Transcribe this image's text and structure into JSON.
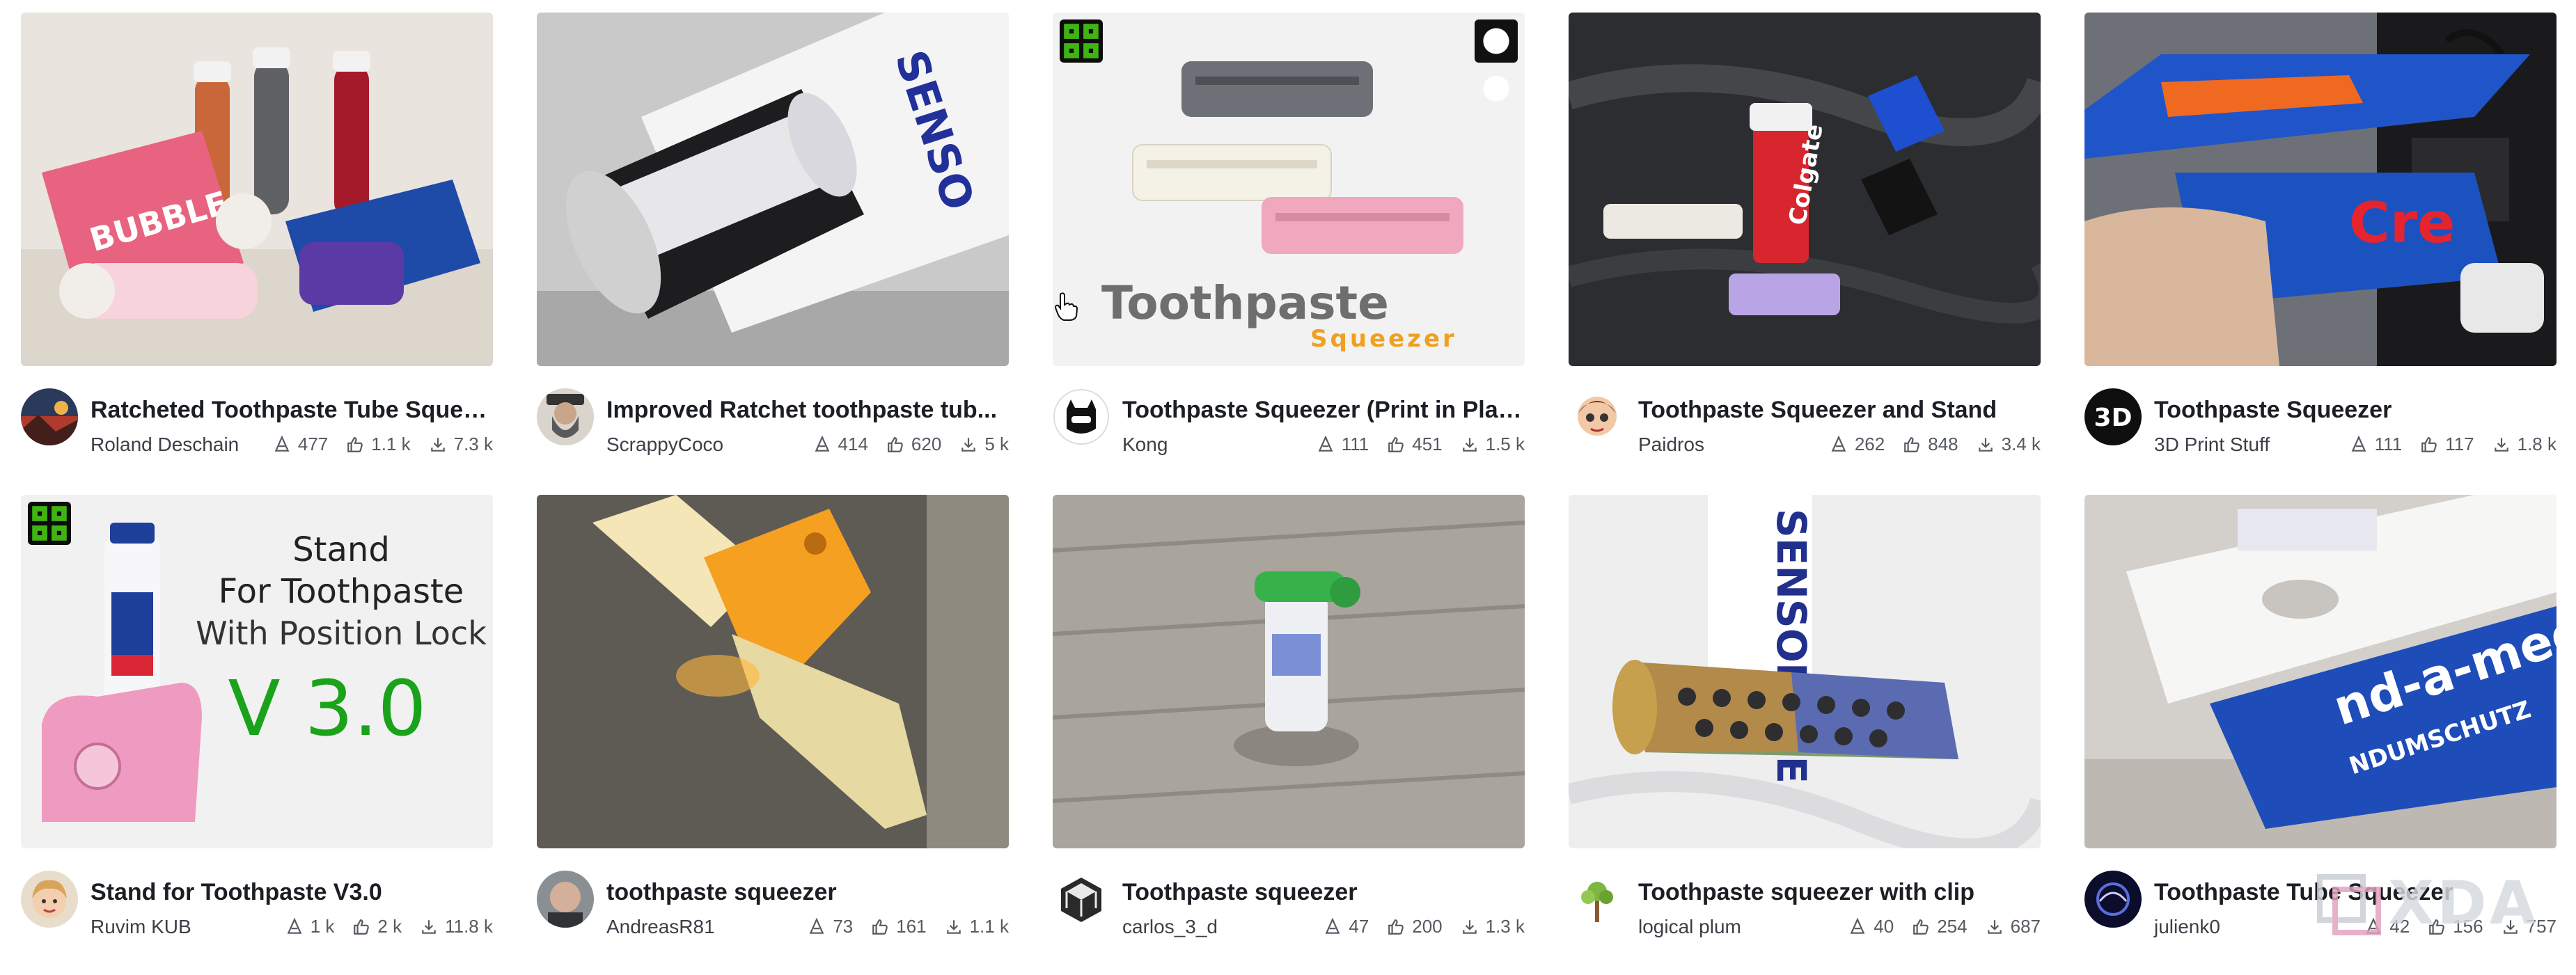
{
  "cards": [
    {
      "title": "Ratcheted Toothpaste Tube Squee...",
      "author": "Roland Deschain",
      "makes": "477",
      "likes": "1.1 k",
      "downloads": "7.3 k",
      "thumb_icon": "toothpaste-tubes-photo",
      "avatar_icon": "landscape-avatar-icon"
    },
    {
      "title": "Improved Ratchet toothpaste tub...",
      "author": "ScrappyCoco",
      "makes": "414",
      "likes": "620",
      "downloads": "5 k",
      "thumb_icon": "sensodyne-tube-photo",
      "avatar_icon": "bearded-man-avatar-icon"
    },
    {
      "title": "Toothpaste Squeezer (Print in Place)",
      "author": "Kong",
      "makes": "111",
      "likes": "451",
      "downloads": "1.5 k",
      "thumb_icon": "squeezer-keys-photo",
      "avatar_icon": "robot-head-avatar-icon",
      "thumb_text": "Toothpaste",
      "thumb_subtext": "Squeezer"
    },
    {
      "title": "Toothpaste Squeezer and Stand",
      "author": "Paidros",
      "makes": "262",
      "likes": "848",
      "downloads": "3.4 k",
      "thumb_icon": "colgate-tube-photo",
      "avatar_icon": "cartoon-avatar-icon"
    },
    {
      "title": "Toothpaste Squeezer",
      "author": "3D Print Stuff",
      "makes": "111",
      "likes": "117",
      "downloads": "1.8 k",
      "thumb_icon": "hand-printer-photo",
      "avatar_icon": "3d-logo-avatar-icon",
      "avatar_text": "3D"
    },
    {
      "title": "Stand for Toothpaste V3.0",
      "author": "Ruvim KUB",
      "makes": "1 k",
      "likes": "2 k",
      "downloads": "11.8 k",
      "thumb_icon": "pink-stand-photo",
      "avatar_icon": "child-avatar-icon",
      "thumb_lines": [
        "Stand",
        "For Toothpaste",
        "With Position Lock"
      ],
      "thumb_version": "V 3.0"
    },
    {
      "title": "toothpaste squeezer",
      "author": "AndreasR81",
      "makes": "73",
      "likes": "161",
      "downloads": "1.1 k",
      "thumb_icon": "orange-clip-photo",
      "avatar_icon": "bald-man-avatar-icon"
    },
    {
      "title": "Toothpaste squeezer",
      "author": "carlos_3_d",
      "makes": "47",
      "likes": "200",
      "downloads": "1.3 k",
      "thumb_icon": "small-tube-floor-photo",
      "avatar_icon": "cube-avatar-icon"
    },
    {
      "title": "Toothpaste squeezer with clip",
      "author": "logical plum",
      "makes": "40",
      "likes": "254",
      "downloads": "687",
      "thumb_icon": "metal-roller-photo",
      "avatar_icon": "tree-avatar-icon"
    },
    {
      "title": "Toothpaste Tube Squeezer",
      "author": "julienk0",
      "makes": "42",
      "likes": "156",
      "downloads": "757",
      "thumb_icon": "white-key-photo",
      "avatar_icon": "logo-avatar-icon"
    }
  ],
  "watermark": "XDA",
  "colors": {
    "accent": "#46a80a",
    "badge_bg": "#0c0c0c",
    "text": "#1b1e23",
    "muted": "#555a61"
  }
}
